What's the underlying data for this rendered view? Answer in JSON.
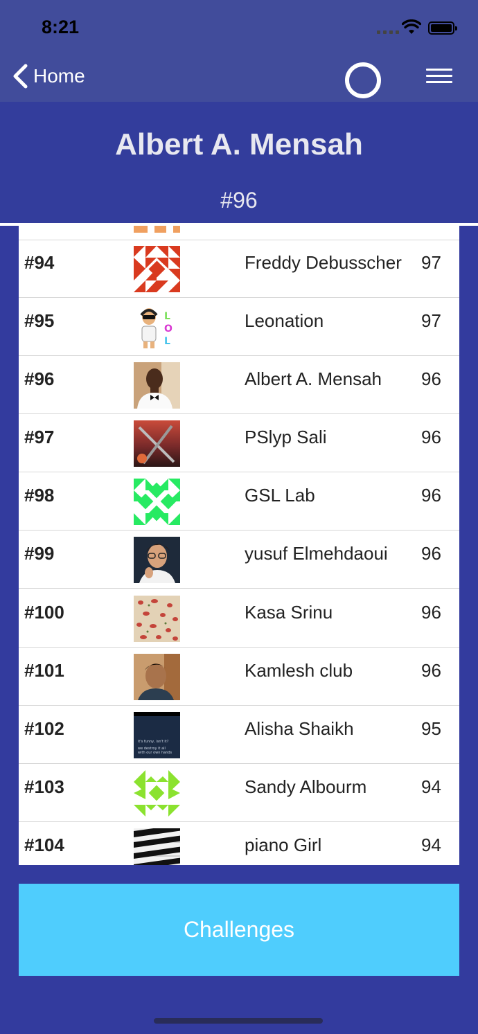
{
  "status_bar": {
    "time": "8:21"
  },
  "nav": {
    "back_label": "Home",
    "menu_icon": "hamburger-menu-icon",
    "activity_icon": "ring-loader-icon"
  },
  "profile": {
    "name": "Albert A. Mensah",
    "rank": "#96"
  },
  "leaderboard": {
    "rows": [
      {
        "rank": "#94",
        "name": "Freddy Debusscher",
        "score": "97",
        "avatar": "red-geometric-pattern"
      },
      {
        "rank": "#95",
        "name": "Leonation",
        "score": "97",
        "avatar": "cartoon-lol"
      },
      {
        "rank": "#96",
        "name": "Albert A. Mensah",
        "score": "96",
        "avatar": "photo-man-bowtie"
      },
      {
        "rank": "#97",
        "name": "PSlyp Sali",
        "score": "96",
        "avatar": "photo-swords"
      },
      {
        "rank": "#98",
        "name": "GSL Lab",
        "score": "96",
        "avatar": "green-geometric-pattern"
      },
      {
        "rank": "#99",
        "name": "yusuf Elmehdaoui",
        "score": "96",
        "avatar": "photo-man-glasses"
      },
      {
        "rank": "#100",
        "name": "Kasa Srinu",
        "score": "96",
        "avatar": "photo-floral"
      },
      {
        "rank": "#101",
        "name": "Kamlesh club",
        "score": "96",
        "avatar": "photo-man-selfie"
      },
      {
        "rank": "#102",
        "name": "Alisha Shaikh",
        "score": "95",
        "avatar": "quote-card",
        "avatar_text": [
          "it's funny, isn't it?",
          "we destroy it all",
          "with our own hands"
        ]
      },
      {
        "rank": "#103",
        "name": "Sandy Albourm",
        "score": "94",
        "avatar": "lime-geometric-pattern"
      },
      {
        "rank": "#104",
        "name": "piano Girl",
        "score": "94",
        "avatar": "photo-piano-keys"
      }
    ]
  },
  "bottom": {
    "challenges_label": "Challenges"
  },
  "colors": {
    "nav_bg": "#414c9b",
    "page_bg": "#333b9e",
    "button_bg": "#4fcdfd"
  }
}
